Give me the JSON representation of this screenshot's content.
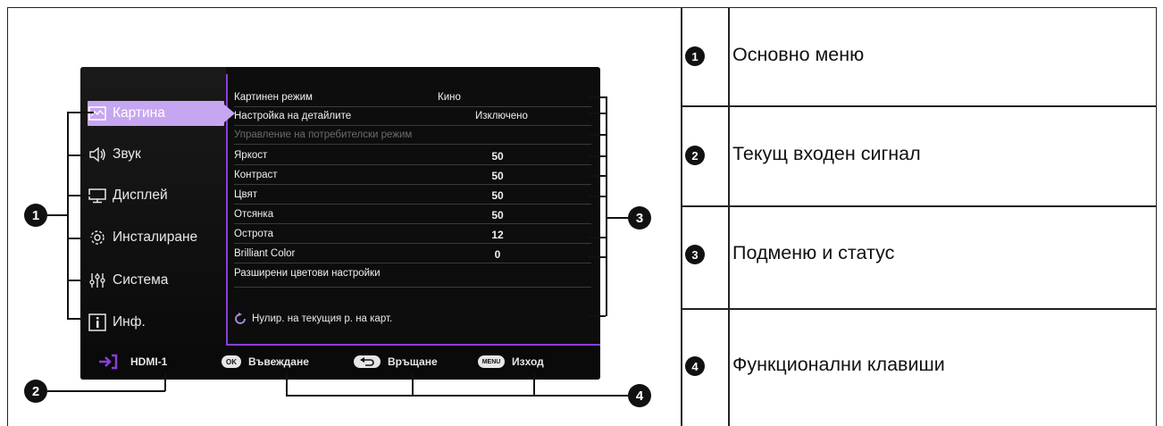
{
  "menu": {
    "items": [
      {
        "label": "Картина",
        "icon": "picture-icon",
        "active": true
      },
      {
        "label": "Звук",
        "icon": "speaker-icon"
      },
      {
        "label": "Дисплей",
        "icon": "display-icon"
      },
      {
        "label": "Инсталиране",
        "icon": "gear-icon"
      },
      {
        "label": "Система",
        "icon": "sliders-icon"
      },
      {
        "label": "Инф.",
        "icon": "info-icon"
      }
    ]
  },
  "submenu": {
    "rows": [
      {
        "label": "Картинен режим",
        "value": "Кино"
      },
      {
        "label": "Настройка на детайлите",
        "value": "Изключено"
      },
      {
        "label": "Управление на потребителски режим",
        "value": "",
        "disabled": true
      },
      {
        "label": "Яркост",
        "value": "50"
      },
      {
        "label": "Контраст",
        "value": "50"
      },
      {
        "label": "Цвят",
        "value": "50"
      },
      {
        "label": "Отсянка",
        "value": "50"
      },
      {
        "label": "Острота",
        "value": "12"
      },
      {
        "label": "Brilliant Color",
        "value": "0"
      },
      {
        "label": "Разширени цветови настройки",
        "value": ""
      }
    ],
    "reset_label": "Нулир. на текущия р. на карт."
  },
  "status": {
    "input_source": "HDMI-1"
  },
  "keys": {
    "ok_badge": "OK",
    "ok_label": "Въвеждане",
    "back_label": "Връщане",
    "menu_badge": "MENU",
    "menu_label": "Изход"
  },
  "callouts": {
    "n1": "1",
    "n2": "2",
    "n3": "3",
    "n4": "4"
  },
  "legend": [
    {
      "num": "1",
      "text": "Основно меню"
    },
    {
      "num": "2",
      "text": "Текущ входен сигнал"
    },
    {
      "num": "3",
      "text": "Подменю и статус"
    },
    {
      "num": "4",
      "text": "Функционални клавиши"
    }
  ],
  "colors": {
    "accent": "#8a3fd6",
    "active_tab": "#c6a6f0",
    "osd_bg": "#0d0d0d"
  }
}
